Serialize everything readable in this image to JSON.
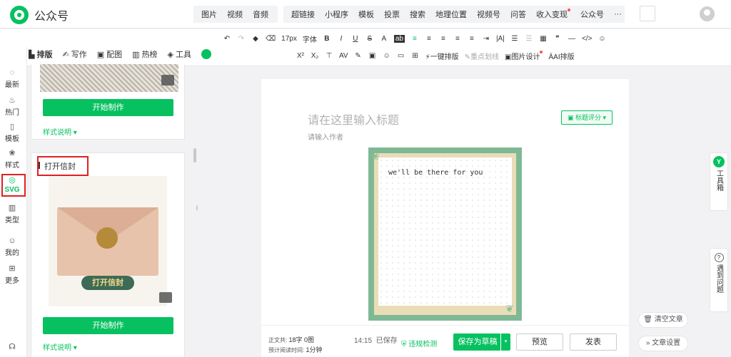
{
  "app": {
    "name": "公众号"
  },
  "topmenu": {
    "group1": [
      "图片",
      "视频",
      "音频"
    ],
    "group2": [
      "超链接",
      "小程序",
      "模板",
      "投票",
      "搜索",
      "地理位置",
      "视频号",
      "问答",
      "收入变现",
      "公众号",
      "···"
    ]
  },
  "toolbar": {
    "font_size": "17px",
    "font_label": "字体",
    "one_click_layout": "一键排版",
    "focus_line": "重点划线",
    "image_design": "图片设计",
    "ai_layout": "AI排版"
  },
  "tabs": [
    {
      "label": "排版",
      "icon": "layout-icon"
    },
    {
      "label": "写作",
      "icon": "pen-icon"
    },
    {
      "label": "配图",
      "icon": "image-icon"
    },
    {
      "label": "热榜",
      "icon": "chart-icon"
    },
    {
      "label": "工具",
      "icon": "cube-icon"
    }
  ],
  "sidebar": {
    "items": [
      {
        "label": "最新",
        "icon": "bubble-icon"
      },
      {
        "label": "热门",
        "icon": "flame-icon"
      },
      {
        "label": "模板",
        "icon": "template-icon"
      },
      {
        "label": "样式",
        "icon": "style-icon"
      },
      {
        "label": "SVG",
        "icon": "svg-icon"
      },
      {
        "label": "类型",
        "icon": "type-icon"
      },
      {
        "label": "我的",
        "icon": "user-icon"
      },
      {
        "label": "更多",
        "icon": "grid-icon"
      }
    ]
  },
  "panel": {
    "start_label": "开始制作",
    "desc_label": "样式说明",
    "card2_title": "打开信封",
    "envelope_button": "打开信封"
  },
  "editor": {
    "title_placeholder": "请在这里输入标题",
    "author_placeholder": "请输入作者",
    "title_score": "标题评分",
    "letter_text": "we'll be there for you"
  },
  "status": {
    "word_count_label": "正文共:",
    "word_count_value": "18字 0图",
    "read_time_label": "预计阅读时间:",
    "read_time_value": "1分钟",
    "saved_time": "14:15",
    "saved_label": "已保存",
    "violation_check": "违规检测"
  },
  "actions": {
    "save_draft": "保存为草稿",
    "preview": "预览",
    "publish": "发表"
  },
  "right": {
    "toolbox": "工具箱",
    "help": "遇到问题",
    "clear": "清空文章",
    "settings": "文章设置"
  }
}
